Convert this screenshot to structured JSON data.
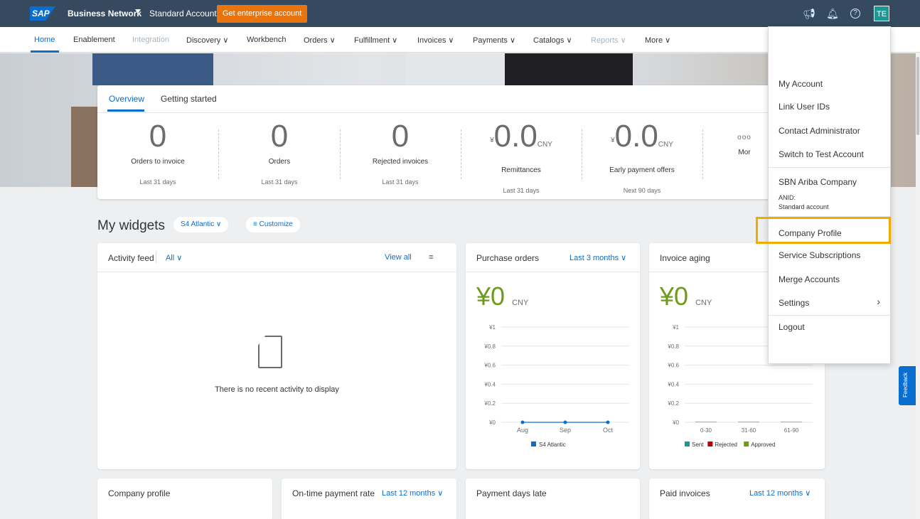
{
  "shell": {
    "logo": "SAP",
    "title": "Business Network",
    "account": "Standard Account",
    "enterprise_button": "Get enterprise account",
    "avatar": "TE"
  },
  "nav": {
    "items": [
      "Home",
      "Enablement",
      "Integration",
      "Discovery ∨",
      "Workbench",
      "Orders ∨",
      "Fulfillment ∨",
      "Invoices ∨",
      "Payments ∨",
      "Catalogs ∨",
      "Reports ∨",
      "More ∨"
    ]
  },
  "overview": {
    "tabs": [
      "Overview",
      "Getting started"
    ],
    "tiles": [
      {
        "value": "0",
        "currency": "",
        "unit": "",
        "label": "Orders to invoice",
        "sub": "Last 31 days"
      },
      {
        "value": "0",
        "currency": "",
        "unit": "",
        "label": "Orders",
        "sub": "Last 31 days"
      },
      {
        "value": "0",
        "currency": "",
        "unit": "",
        "label": "Rejected invoices",
        "sub": "Last 31 days"
      },
      {
        "value": "0.0",
        "currency": "¥",
        "unit": "CNY",
        "label": "Remittances",
        "sub": "Last 31 days"
      },
      {
        "value": "0.0",
        "currency": "¥",
        "unit": "CNY",
        "label": "Early payment offers",
        "sub": "Next 90 days"
      },
      {
        "value": "ooo",
        "currency": "",
        "unit": "",
        "label": "Mor",
        "sub": ""
      }
    ]
  },
  "widgets": {
    "title": "My widgets",
    "filter": "S4 Atlantic ∨",
    "customize": "Customize"
  },
  "activity": {
    "title": "Activity feed",
    "filter": "All ∨",
    "view_all": "View all",
    "empty": "There is no recent activity to display"
  },
  "purchase_orders": {
    "title": "Purchase orders",
    "period": "Last 3 months ∨",
    "total": "¥0",
    "unit": "CNY",
    "legend": "S4 Atlantic"
  },
  "invoice_aging": {
    "title": "Invoice aging",
    "total": "¥0",
    "unit": "CNY",
    "legend": [
      "Sent",
      "Rejected",
      "Approved"
    ]
  },
  "bottom_cards": {
    "company_profile": "Company profile",
    "on_time": "On-time payment rate",
    "on_time_period": "Last 12 months ∨",
    "days_late": "Payment days late",
    "paid_invoices": "Paid invoices",
    "paid_period": "Last 12 months ∨"
  },
  "menu": {
    "my_account": "My Account",
    "link_user_ids": "Link User IDs",
    "contact_admin": "Contact Administrator",
    "switch_test": "Switch to Test Account",
    "company_name": "SBN Ariba Company",
    "anid_label": "ANID:",
    "account_type": "Standard account",
    "company_profile": "Company Profile",
    "service_subscriptions": "Service Subscriptions",
    "merge_accounts": "Merge Accounts",
    "settings": "Settings",
    "logout": "Logout"
  },
  "feedback": "Feedback",
  "chart_data": [
    {
      "type": "line",
      "title": "Purchase orders",
      "categories": [
        "Aug",
        "Sep",
        "Oct"
      ],
      "series": [
        {
          "name": "S4 Atlantic",
          "values": [
            0,
            0,
            0
          ],
          "color": "#0a6ed1"
        }
      ],
      "yticks": [
        "¥1",
        "¥0.8",
        "¥0.6",
        "¥0.4",
        "¥0.2",
        "¥0"
      ],
      "ylim": [
        0,
        1
      ]
    },
    {
      "type": "bar",
      "title": "Invoice aging",
      "categories": [
        "0-30",
        "31-60",
        "61-90"
      ],
      "series": [
        {
          "name": "Sent",
          "values": [
            0,
            0,
            0
          ],
          "color": "#1a9898"
        },
        {
          "name": "Rejected",
          "values": [
            0,
            0,
            0
          ],
          "color": "#bb0000"
        },
        {
          "name": "Approved",
          "values": [
            0,
            0,
            0
          ],
          "color": "#6c9b1e"
        }
      ],
      "yticks": [
        "¥1",
        "¥0.8",
        "¥0.6",
        "¥0.4",
        "¥0.2",
        "¥0"
      ],
      "ylim": [
        0,
        1
      ]
    }
  ]
}
